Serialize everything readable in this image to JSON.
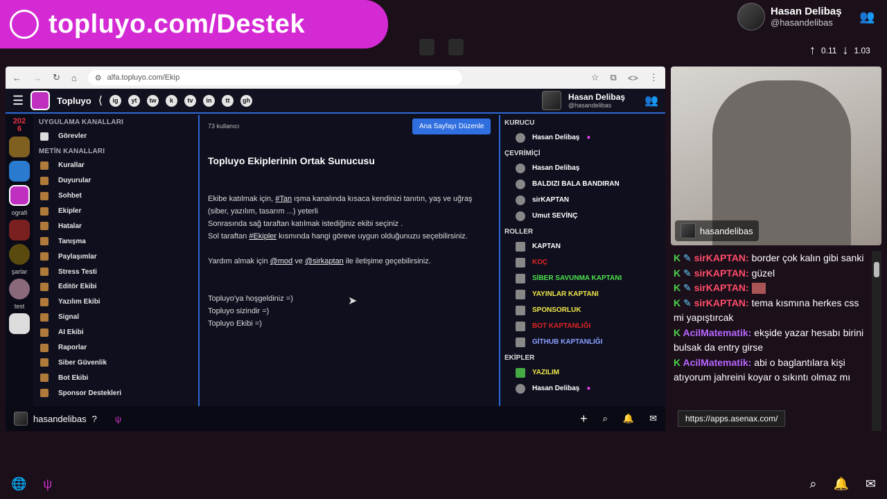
{
  "banner": {
    "title": "topluyo.com/Destek"
  },
  "streamer": {
    "name": "Hasan Delibaş",
    "handle": "@hasandelibas",
    "up": "0.11",
    "down": "1.03"
  },
  "browser": {
    "url": "alfa.topluyo.com/Ekip"
  },
  "app": {
    "brand": "Topluyo",
    "user_name": "Hasan Delibaş",
    "user_handle": "@hasandelibas",
    "social": [
      "ig",
      "yt",
      "tw",
      "k",
      "tv",
      "in",
      "tt",
      "gh"
    ],
    "year": "2026",
    "rail_labels": [
      "ografi",
      "şarlar",
      "test"
    ],
    "channels": {
      "app_header": "UYGULAMA KANALLARI",
      "app_items": [
        "Görevler"
      ],
      "text_header": "METİN KANALLARI",
      "text_items": [
        "Kurallar",
        "Duyurular",
        "Sohbet",
        "Ekipler",
        "Hatalar",
        "Tanışma",
        "Paylaşımlar",
        "Stress Testi",
        "Editör Ekibi",
        "Yazılım Ekibi",
        "Signal",
        "AI Ekibi",
        "Raporlar",
        "Siber Güvenlik",
        "Bot Ekibi",
        "Sponsor Destekleri"
      ]
    },
    "main": {
      "count": "73 kullanıcı",
      "edit_button": "Ana Sayfayı Düzenle",
      "title": "Topluyo Ekiplerinin Ortak Sunucusu",
      "p1a": "Ekibe katılmak için,",
      "tag_tan": "#Tan",
      "p1b": "ışma kanalında kısaca kendinizi tanıtın, yaş ve uğraş (siber, yazılım, tasarım ...) yeterli",
      "p2": "Sonrasında sağ taraftan katılmak istediğiniz ekibi seçiniz .",
      "p3a": "Sol taraftan",
      "tag_ekipler": "#Ekipler",
      "p3b": "kısmında hangi göreve uygun olduğunuzu seçebilirsiniz.",
      "p4a": "Yardım almak için",
      "mod": "@mod",
      "and": "ve",
      "kaptan": "@sirkaptan",
      "p4b": "ile iletişime geçebilirsiniz.",
      "l1": "Topluyo'ya hoşgeldiniz =)",
      "l2": "Topluyo sizindir =)",
      "l3": "Topluyo Ekibi =)"
    },
    "right": {
      "founder_h": "KURUCU",
      "founder": "Hasan Delibaş",
      "online_h": "ÇEVRİMİÇİ",
      "online": [
        "Hasan Delibaş",
        "BALDIZI BALA BANDIRAN",
        "sirKAPTAN",
        "Umut SEVİNÇ"
      ],
      "roles_h": "ROLLER",
      "roles": [
        {
          "label": "KAPTAN",
          "color": "#ffffff"
        },
        {
          "label": "KOÇ",
          "color": "#e02424"
        },
        {
          "label": "SİBER SAVUNMA KAPTANI",
          "color": "#4ee24e"
        },
        {
          "label": "YAYINLAR KAPTANI",
          "color": "#f2e94a"
        },
        {
          "label": "SPONSORLUK",
          "color": "#f2e94a"
        },
        {
          "label": "BOT KAPTANLIĞI",
          "color": "#e02424"
        },
        {
          "label": "GİTHUB KAPTANLIĞI",
          "color": "#8aa0ff"
        }
      ],
      "teams_h": "EKİPLER",
      "team": "YAZILIM",
      "team_member": "Hasan Delibaş"
    },
    "bottom_user": "hasandelibas"
  },
  "cam": {
    "label": "hasandelibas"
  },
  "chat": [
    {
      "user": "sirKAPTAN:",
      "text": "border çok kalın gibi sanki",
      "cls": "u1"
    },
    {
      "user": "sirKAPTAN:",
      "text": "güzel",
      "cls": "u1"
    },
    {
      "user": "sirKAPTAN:",
      "text": "",
      "cls": "u1"
    },
    {
      "user": "sirKAPTAN:",
      "text": "tema kısmına herkes css mi yapıştırcak",
      "cls": "u1"
    },
    {
      "user": "AcilMatematik:",
      "text": "ekşide yazar hesabı birini bulsak da entry girse",
      "cls": "u2"
    },
    {
      "user": "AcilMatematik:",
      "text": "abi o baglantılara kişi atıyorum jahreini koyar o sıkıntı olmaz mı",
      "cls": "u2"
    }
  ],
  "popup_url": "https://apps.asenax.com/"
}
